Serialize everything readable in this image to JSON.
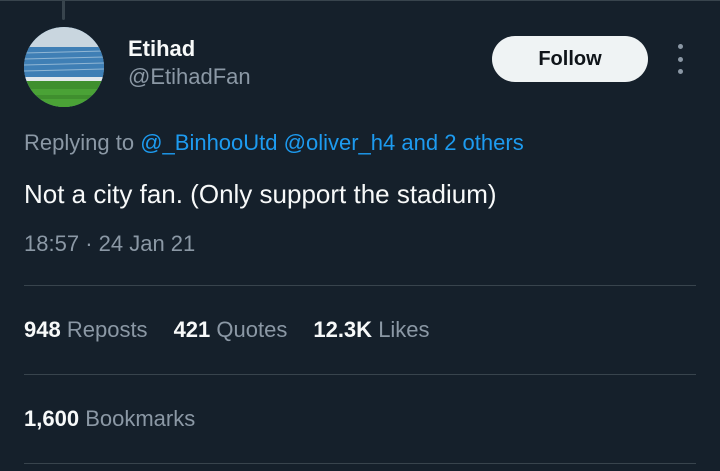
{
  "user": {
    "display_name": "Etihad",
    "handle": "@EtihadFan",
    "follow_label": "Follow"
  },
  "reply": {
    "prefix": "Replying to",
    "mentions": [
      "@_BinhooUtd",
      "@oliver_h4"
    ],
    "others": "and 2 others"
  },
  "tweet": {
    "text": "Not a city fan. (Only support the stadium)",
    "time": "18:57",
    "separator": "·",
    "date": "24 Jan 21"
  },
  "stats": {
    "reposts": {
      "value": "948",
      "label": "Reposts"
    },
    "quotes": {
      "value": "421",
      "label": "Quotes"
    },
    "likes": {
      "value": "12.3K",
      "label": "Likes"
    },
    "bookmarks": {
      "value": "1,600",
      "label": "Bookmarks"
    }
  },
  "colors": {
    "background": "#15202b",
    "accent": "#1d9bf0",
    "secondary_text": "#8b98a5",
    "divider": "#38444d"
  },
  "icons": {
    "more": "more-horizontal-icon"
  }
}
